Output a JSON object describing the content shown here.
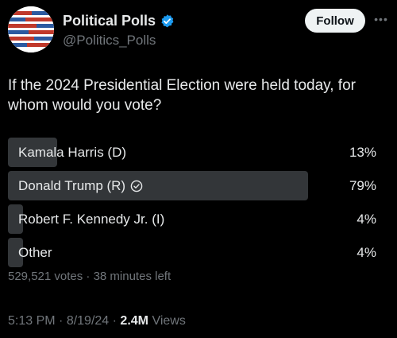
{
  "author": {
    "display_name": "Political Polls",
    "handle": "@Politics_Polls",
    "verified": true,
    "follow_label": "Follow",
    "more_glyph": "•••"
  },
  "question": "If the 2024 Presidential Election were held today, for whom would you vote?",
  "poll": {
    "options": [
      {
        "label": "Kamala Harris (D)",
        "percent_text": "13%",
        "percent": 13,
        "selected": false
      },
      {
        "label": "Donald Trump (R)",
        "percent_text": "79%",
        "percent": 79,
        "selected": true
      },
      {
        "label": "Robert F. Kennedy Jr. (I)",
        "percent_text": "4%",
        "percent": 4,
        "selected": false
      },
      {
        "label": "Other",
        "percent_text": "4%",
        "percent": 4,
        "selected": false
      }
    ],
    "meta": "529,521 votes · 38 minutes left"
  },
  "footer": {
    "time": "5:13 PM",
    "sep1": " · ",
    "date": "8/19/24",
    "sep2": " · ",
    "views_count": "2.4M",
    "views_label": " Views"
  },
  "colors": {
    "background": "#000000",
    "text": "#e7e9ea",
    "muted": "#71767b",
    "bar": "#333639",
    "verified": "#1d9bf0"
  }
}
